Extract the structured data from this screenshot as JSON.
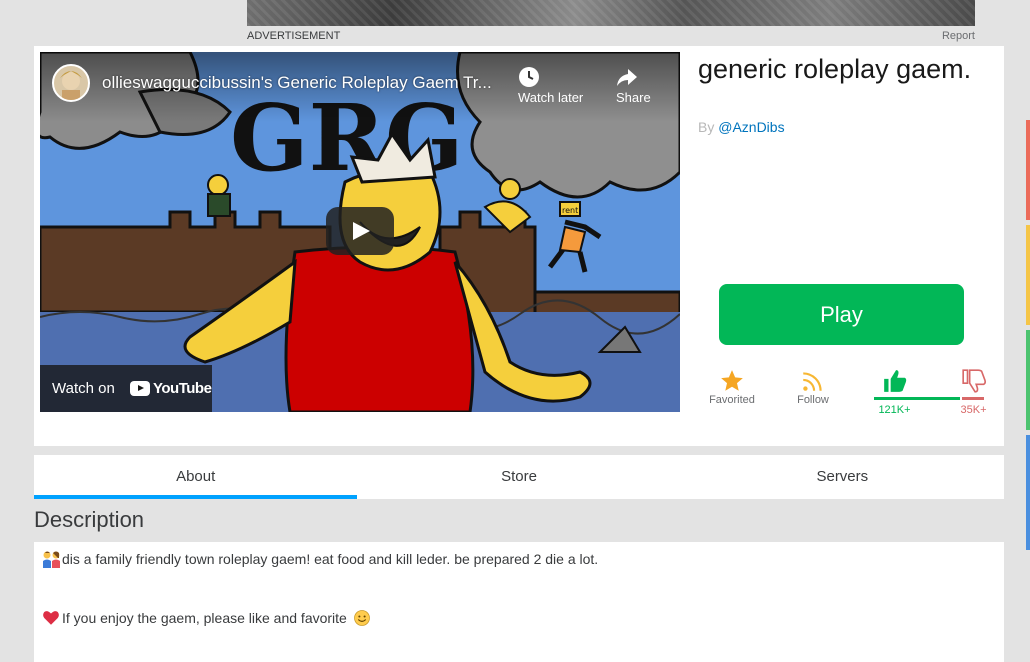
{
  "ad": {
    "label": "ADVERTISEMENT",
    "report": "Report"
  },
  "video": {
    "title": "ollieswagguccibussin's Generic Roleplay Gaem Tr...",
    "watch_later": "Watch later",
    "share": "Share",
    "watch_on": "Watch on",
    "youtube": "YouTube",
    "thumb_text": "GRG",
    "sign_text": "rent"
  },
  "game": {
    "title": "generic roleplay gaem.",
    "by_prefix": "By ",
    "creator": "@AznDibs",
    "play_label": "Play"
  },
  "actions": {
    "favorited": "Favorited",
    "follow": "Follow",
    "upvotes": "121K+",
    "downvotes": "35K+",
    "like_ratio": 0.78
  },
  "tabs": [
    "About",
    "Store",
    "Servers"
  ],
  "description": {
    "heading": "Description",
    "line1": "dis a family friendly town roleplay gaem! eat food and kill leder. be prepared 2 die a lot.",
    "line2": "If you enjoy the gaem, please like and favorite"
  },
  "colors": {
    "play_green": "#02b757",
    "tab_accent": "#00a2ff",
    "link_blue": "#0074bd",
    "favorite_gold": "#f5a623",
    "follow_orange": "#f7b733",
    "downvote_red": "#d86868"
  },
  "icons": {
    "favorite": "star-icon",
    "follow": "rss-icon",
    "upvote": "thumbs-up-icon",
    "downvote": "thumbs-down-icon",
    "watch_later": "clock-icon",
    "share": "share-arrow-icon"
  }
}
